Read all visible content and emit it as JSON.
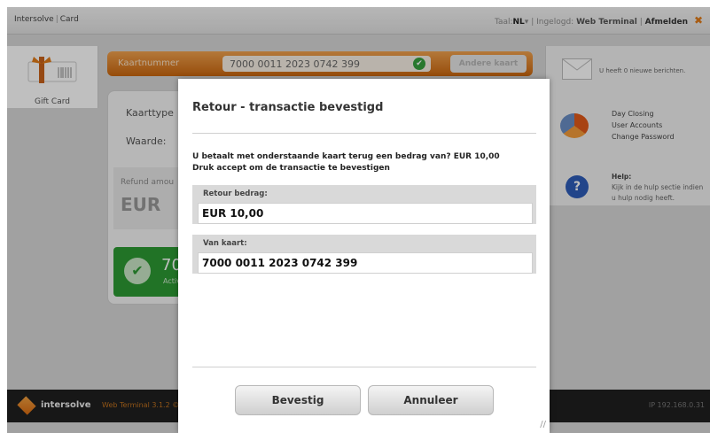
{
  "app": {
    "brand_name": "Intersolve",
    "brand_section": "Card",
    "lang_label": "Taal:",
    "lang_value": "NL",
    "logged_label": "Ingelogd:",
    "logged_user": "Web Terminal",
    "logout": "Afmelden"
  },
  "left": {
    "gift_label": "Gift Card"
  },
  "cardbar": {
    "label": "Kaartnummer",
    "value": "7000 0011 2023 0742 399",
    "other_button": "Andere kaart"
  },
  "panel": {
    "kaarttype": "Kaarttype",
    "waarde": "Waarde:",
    "refund_label": "Refund amou",
    "eur": "EUR",
    "green_num": "70",
    "green_sub": "Activ"
  },
  "right": {
    "messages": "U heeft 0 nieuwe berichten.",
    "links": [
      "Day Closing",
      "User Accounts",
      "Change Password"
    ],
    "help_title": "Help:",
    "help_text": "Kijk in de hulp sectie indien u hulp nodig heeft."
  },
  "footer": {
    "name": "intersolve",
    "version": "Web Terminal 3.1.2 ©",
    "ip": "IP 192.168.0.31"
  },
  "modal": {
    "title": "Retour - transactie bevestigd",
    "question_line1": "U betaalt met onderstaande kaart terug een bedrag van?  EUR 10,00",
    "question_line2": "Druk accept om de transactie te bevestigen",
    "amount_label": "Retour bedrag:",
    "amount_value": "EUR 10,00",
    "card_label": "Van kaart:",
    "card_value": "7000 0011 2023 0742 399",
    "confirm": "Bevestig",
    "cancel": "Annuleer"
  }
}
